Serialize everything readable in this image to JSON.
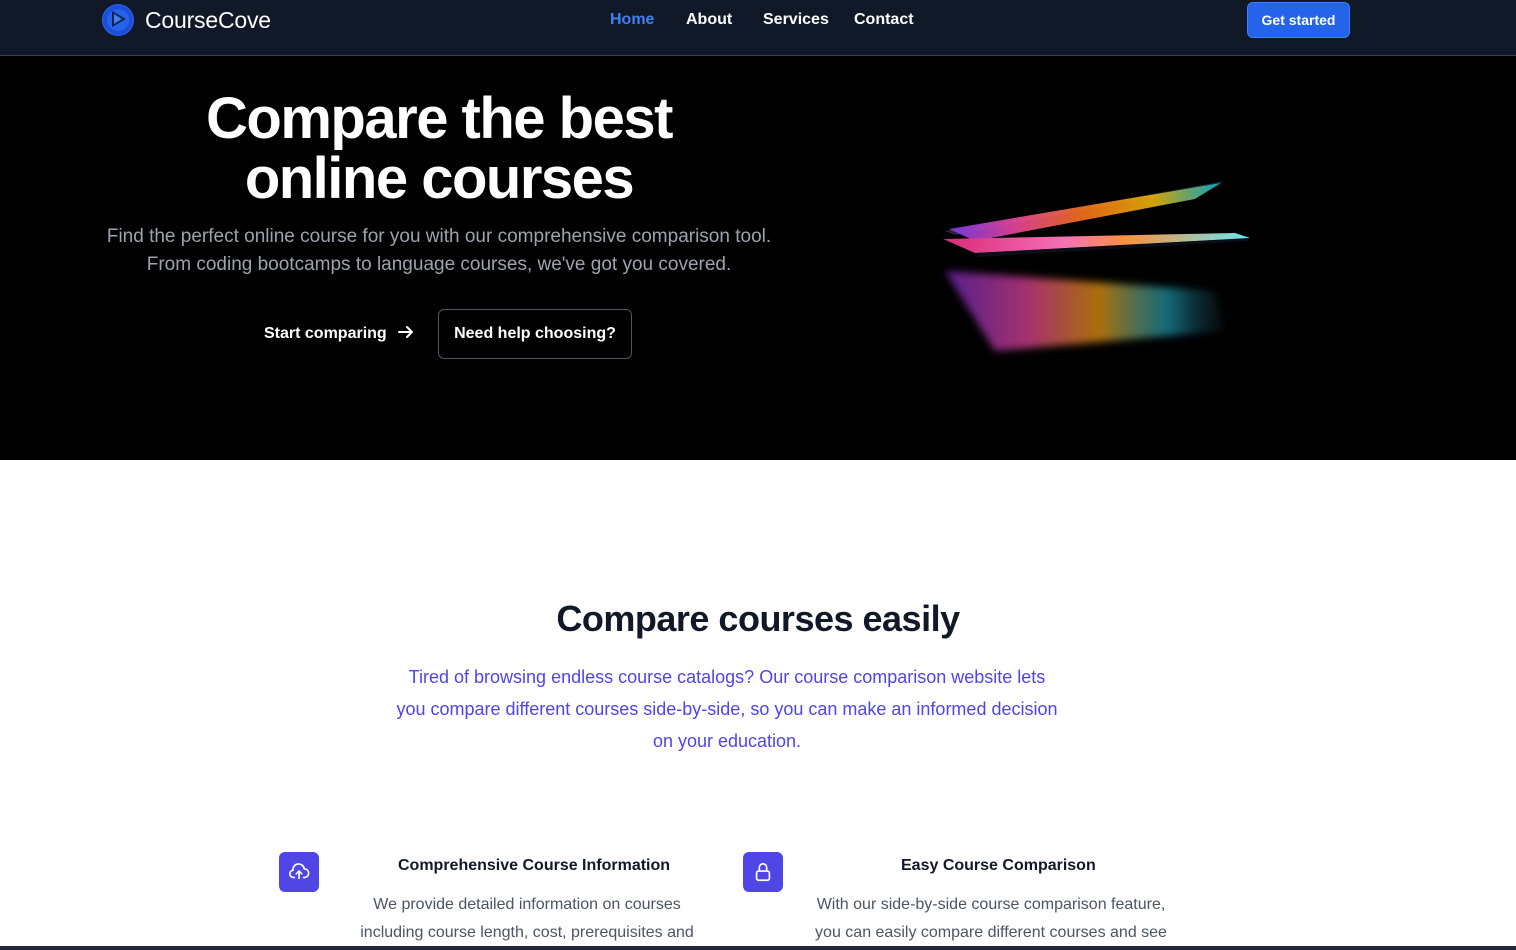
{
  "brand": {
    "name": "CourseCove",
    "accent": "#2563eb"
  },
  "nav": {
    "links": [
      {
        "label": "Home",
        "active": true
      },
      {
        "label": "About",
        "active": false
      },
      {
        "label": "Services",
        "active": false
      },
      {
        "label": "Contact",
        "active": false
      }
    ],
    "cta_label": "Get started"
  },
  "hero": {
    "title_line1": "Compare the best",
    "title_line2": "online courses",
    "subtitle_line1": "Find the perfect online course for you with our comprehensive comparison tool.",
    "subtitle_line2": "From coding bootcamps to language courses, we've got you covered.",
    "primary_label": "Start comparing",
    "primary_icon": "arrow-right-icon",
    "secondary_label": "Need help choosing?",
    "image": "laptop-image"
  },
  "features": {
    "title": "Compare courses easily",
    "description": "Tired of browsing endless course catalogs? Our course comparison website lets you compare different courses side-by-side, so you can make an informed decision on your education.",
    "items": [
      {
        "icon": "cloud-upload-icon",
        "title": "Comprehensive Course Information",
        "text_line1": "We provide detailed information on courses",
        "text_line2": "including course length, cost, prerequisites and"
      },
      {
        "icon": "lock-icon",
        "title": "Easy Course Comparison",
        "text_line1": "With our side-by-side course comparison feature,",
        "text_line2": "you can easily compare different courses and see"
      }
    ],
    "icon_color": "#4f46e5"
  }
}
